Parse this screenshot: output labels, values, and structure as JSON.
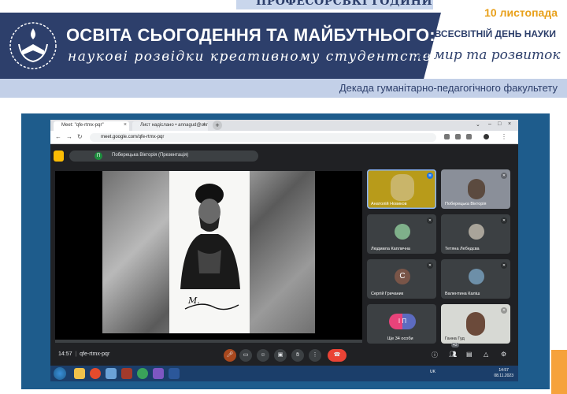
{
  "banner": {
    "kicker": "ПРОФЕСОРСЬКІ ГОДИНИ",
    "title": "ОСВІТА СЬОГОДЕННЯ ТА МАЙБУТНЬОГО:",
    "subtitle": "наукові розвідки креативному студентству",
    "date": "10 листопада",
    "event": "ВСЕСВІТНІЙ ДЕНЬ НАУКИ",
    "motto": "за мир та розвиток",
    "decade": "Декада гуманітарно-педагогічного факультету"
  },
  "browser": {
    "tabs": [
      {
        "label": "Meet: \"qfe-rtmx-pqr\""
      },
      {
        "label": "Лист надіслано • annagud@ukr"
      }
    ],
    "new_tab": "+",
    "url": "meet.google.com/qfe-rtmx-pqr"
  },
  "meet": {
    "presenter_initial": "П",
    "presenter_label": "Поберецька Вікторія (Презентація)",
    "participants": [
      {
        "name": "Анатолій Новиков",
        "initial": ""
      },
      {
        "name": "Поберецька Вікторія",
        "initial": ""
      },
      {
        "name": "Людмила Каплична",
        "initial": ""
      },
      {
        "name": "Тетяна Лебедєва",
        "initial": ""
      },
      {
        "name": "Сергій Гричаник",
        "initial": "С"
      },
      {
        "name": "Валентина Каліш",
        "initial": ""
      },
      {
        "name": "Ще 34 особи",
        "initial": "І П"
      },
      {
        "name": "Ганна Гуд",
        "initial": ""
      }
    ],
    "time": "14:57",
    "meeting_code": "qfe-rtmx-pqr",
    "participant_badge": "43"
  },
  "taskbar": {
    "lang": "UK",
    "time": "14:57",
    "date": "08.11.2023"
  },
  "colors": {
    "navy": "#2d3f6b",
    "orange": "#e8a01a",
    "meet_bg": "#202124",
    "end_call": "#ea4335"
  }
}
